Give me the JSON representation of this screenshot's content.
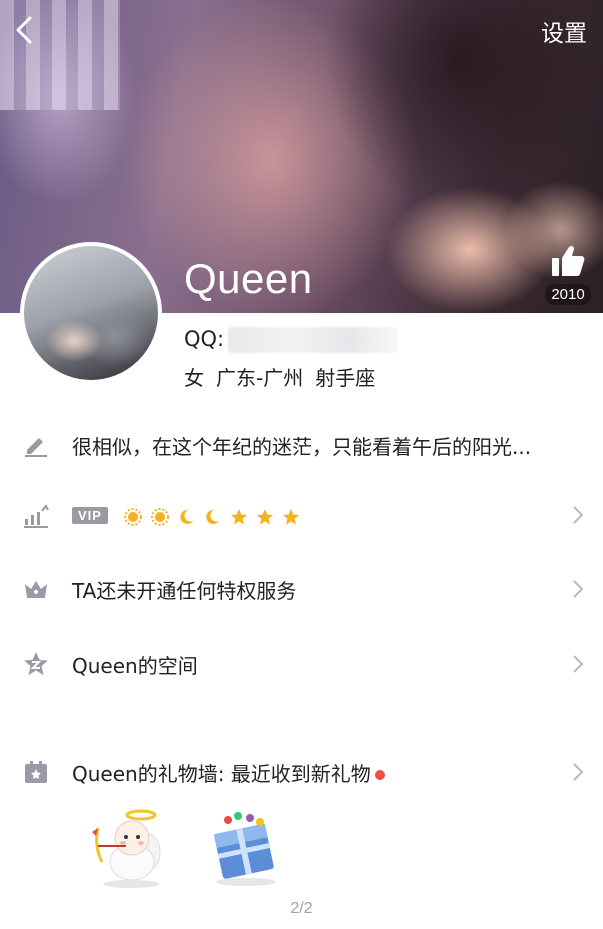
{
  "header": {
    "settings_label": "设置",
    "profile_name": "Queen",
    "like_count": "2010"
  },
  "profile": {
    "qq_label": "QQ:",
    "gender": "女",
    "location": "广东-广州",
    "zodiac": "射手座"
  },
  "rows": {
    "signature": "很相似，在这个年纪的迷茫，只能看着午后的阳光...",
    "vip_badge": "VIP",
    "privilege": "TA还未开通任何特权服务",
    "space": "Queen的空间",
    "gift_wall": "Queen的礼物墙: 最近收到新礼物"
  },
  "colors": {
    "icon_gray": "#9a9aa6",
    "chevron_gray": "#b8b8be",
    "notify_red": "#f04e3e",
    "level_gold": "#f5b21c"
  },
  "icons": {
    "back": "chevron-left-icon",
    "like": "thumbs-up-icon",
    "signature": "pencil-icon",
    "level": "bar-chart-up-icon",
    "privilege": "crown-icon",
    "space": "star-z-icon",
    "gift": "gift-box-icon"
  },
  "gifts": [
    "cupid-angel-gift",
    "birthday-card-gift"
  ],
  "pager": "2/2"
}
